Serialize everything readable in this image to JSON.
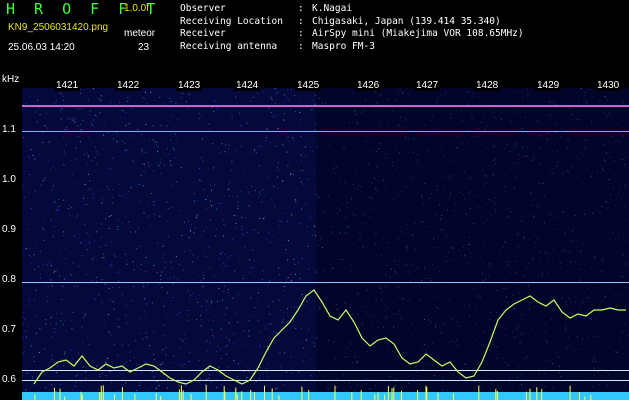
{
  "header": {
    "app_title": "H R O F F T",
    "version": "1.0.0f",
    "filename": "KN9_2506031420.png",
    "mode": "meteor",
    "datetime": "25.06.03 14:20",
    "count": "23"
  },
  "info": [
    {
      "label": "Observer",
      "value": "K.Nagai"
    },
    {
      "label": "Receiving Location",
      "value": "Chigasaki, Japan (139.414 35.340)"
    },
    {
      "label": "Receiver",
      "value": "AirSpy mini (Miakejima VOR 108.65MHz)"
    },
    {
      "label": "Receiving antenna",
      "value": "Maspro FM-3"
    }
  ],
  "axis": {
    "y_unit": "kHz",
    "y_ticks": [
      "1.1",
      "1.0",
      "0.9",
      "0.8",
      "0.7",
      "0.6"
    ],
    "x_ticks": [
      "1421",
      "1422",
      "1423",
      "1424",
      "1425",
      "1426",
      "1427",
      "1428",
      "1429",
      "1430"
    ]
  },
  "colors": {
    "title_green": "#39ff39",
    "label_yellow": "#e8e800",
    "background_plot": "#05083a",
    "trace": "#c8ff60",
    "bottom_bar": "#31c8ff"
  }
}
